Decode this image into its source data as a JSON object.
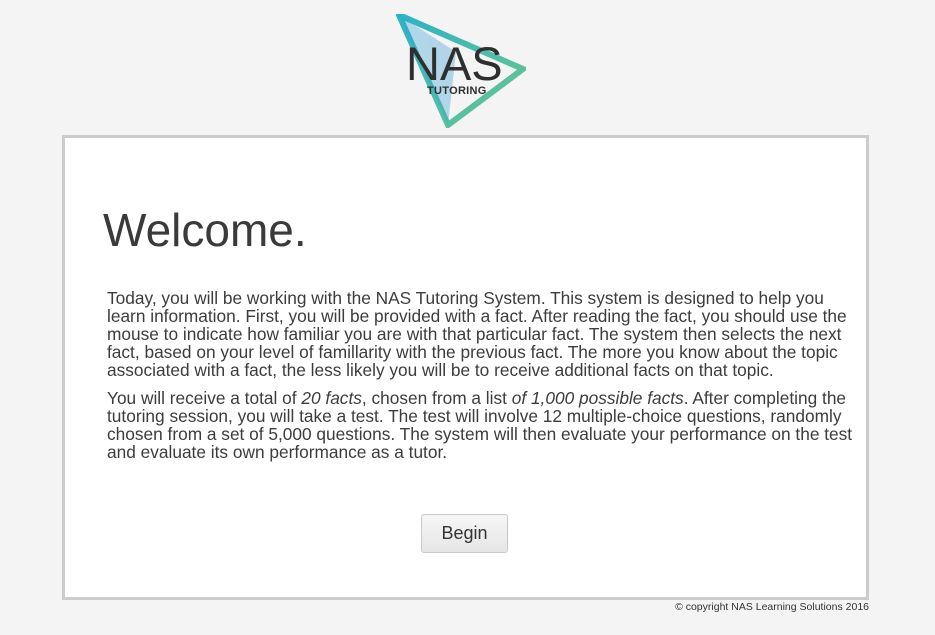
{
  "logo": {
    "main": "NAS",
    "sub": "TUTORING"
  },
  "welcome": {
    "title": "Welcome.",
    "paragraph1": "Today, you will be working with the NAS Tutoring System. This system is designed to help you learn information. First, you will be provided with a fact. After reading the fact, you should use the mouse to indicate how familiar you are with that particular fact. The system then selects the next fact, based on your level of famillarity with the previous fact. The more you know about the topic associated with a fact, the less likely you will be to receive additional facts on that topic.",
    "paragraph2": {
      "part1": "You will receive a total of ",
      "em1": "20 facts",
      "part2": ", chosen from a list ",
      "em2": "of 1,000 possible facts",
      "part3": ". After completing the tutoring session, you will take a test. The test will involve 12 multiple-choice questions, randomly chosen from a set of 5,000 questions. The system will then evaluate your performance on the test and evaluate its own performance as a tutor."
    },
    "begin_label": "Begin"
  },
  "footer": {
    "copyright": "© copyright NAS Learning Solutions 2016"
  },
  "colors": {
    "logo_teal": "#2bb3c9",
    "logo_green": "#6cc68c",
    "logo_blue": "#3a8fd6",
    "card_border": "#cccccc",
    "page_background": "#f4f4f4"
  },
  "icons": {
    "logo_mark": "triangle-logo-icon"
  }
}
